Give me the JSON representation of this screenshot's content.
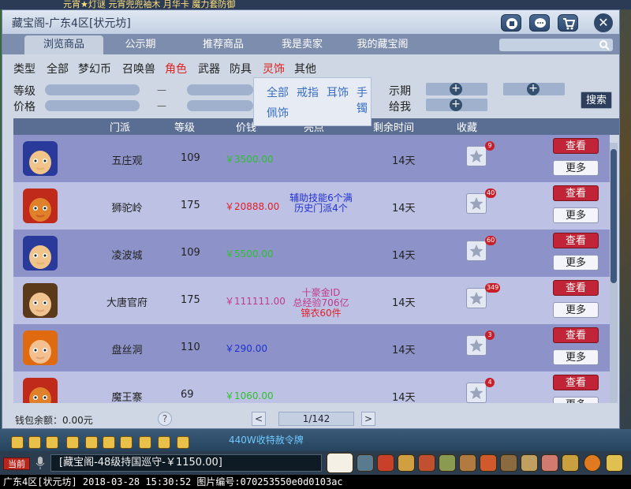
{
  "scene": {
    "top_ticker": "元宵★灯谜  元宵兜兜袖木  月华卡  魔力套防御"
  },
  "window": {
    "title": "藏宝阁-广东4区[状元坊]",
    "close_label": "✕",
    "tabs": [
      {
        "label": "浏览商品"
      },
      {
        "label": "公示期"
      },
      {
        "label": "推荐商品"
      },
      {
        "label": "我是卖家"
      },
      {
        "label": "我的藏宝阁"
      }
    ],
    "search_placeholder": ""
  },
  "categories": [
    {
      "label": "类型"
    },
    {
      "label": "全部"
    },
    {
      "label": "梦幻币"
    },
    {
      "label": "召唤兽"
    },
    {
      "label": "角色"
    },
    {
      "label": "武器"
    },
    {
      "label": "防具"
    },
    {
      "label": "灵饰"
    },
    {
      "label": "其他"
    }
  ],
  "dropdown": {
    "items": [
      {
        "label": "全部"
      },
      {
        "label": "戒指"
      },
      {
        "label": "耳饰"
      },
      {
        "label": "手镯"
      },
      {
        "label": "佩饰"
      }
    ]
  },
  "filters": {
    "level_label": "等级",
    "price_label": "价格",
    "range_sep": "—",
    "public_label": "示期",
    "give_label": "给我",
    "plus": "+",
    "search_button": "搜索"
  },
  "table": {
    "headers": [
      "门派",
      "等级",
      "价钱",
      "亮点",
      "剩余时间",
      "收藏"
    ],
    "view_label": "查看",
    "more_label": "更多",
    "rows": [
      {
        "school": "五庄观",
        "level": "109",
        "price": "￥3500.00",
        "price_color": "#2fbf2f",
        "note": [
          "",
          "",
          ""
        ],
        "remaining": "14天",
        "favorites": "9",
        "avatar": "blue"
      },
      {
        "school": "狮驼岭",
        "level": "175",
        "price": "￥20888.00",
        "price_color": "#e0202a",
        "note": [
          "辅助技能6个满",
          "历史门派4个",
          ""
        ],
        "note_colors": [
          "#2030d0",
          "#2030d0",
          ""
        ],
        "remaining": "14天",
        "favorites": "40",
        "avatar": "red"
      },
      {
        "school": "凌波城",
        "level": "109",
        "price": "￥5500.00",
        "price_color": "#2fbf2f",
        "note": [
          "",
          "",
          ""
        ],
        "remaining": "14天",
        "favorites": "60",
        "avatar": "blue"
      },
      {
        "school": "大唐官府",
        "level": "175",
        "price": "￥111111.00",
        "price_color": "#c03a8a",
        "note": [
          "十豪金ID",
          "总经验706亿",
          "锦衣60件"
        ],
        "note_colors": [
          "#c03a8a",
          "#c03a8a",
          "#e0202a"
        ],
        "remaining": "14天",
        "favorites": "349",
        "avatar": "brown"
      },
      {
        "school": "盘丝洞",
        "level": "110",
        "price": "￥290.00",
        "price_color": "#2030d0",
        "note": [
          "",
          "",
          ""
        ],
        "remaining": "14天",
        "favorites": "3",
        "avatar": "orange"
      },
      {
        "school": "魔王寨",
        "level": "69",
        "price": "￥1060.00",
        "price_color": "#2fbf2f",
        "note": [
          "",
          "",
          ""
        ],
        "remaining": "14天",
        "favorites": "4",
        "avatar": "red"
      }
    ]
  },
  "footer": {
    "wallet": "钱包余额：0.00元",
    "help": "?",
    "prev": "<",
    "next": ">",
    "page": "1/142"
  },
  "hud": {
    "broadcast": "440W收特赦令牌",
    "current_label": "当前",
    "chat_text": "[藏宝阁-48级持国巡守-￥1150.00]"
  },
  "statusbar": {
    "text": "广东4区[状元坊] 2018-03-28 15:30:52 图片编号:070253550e0d0103ac"
  }
}
